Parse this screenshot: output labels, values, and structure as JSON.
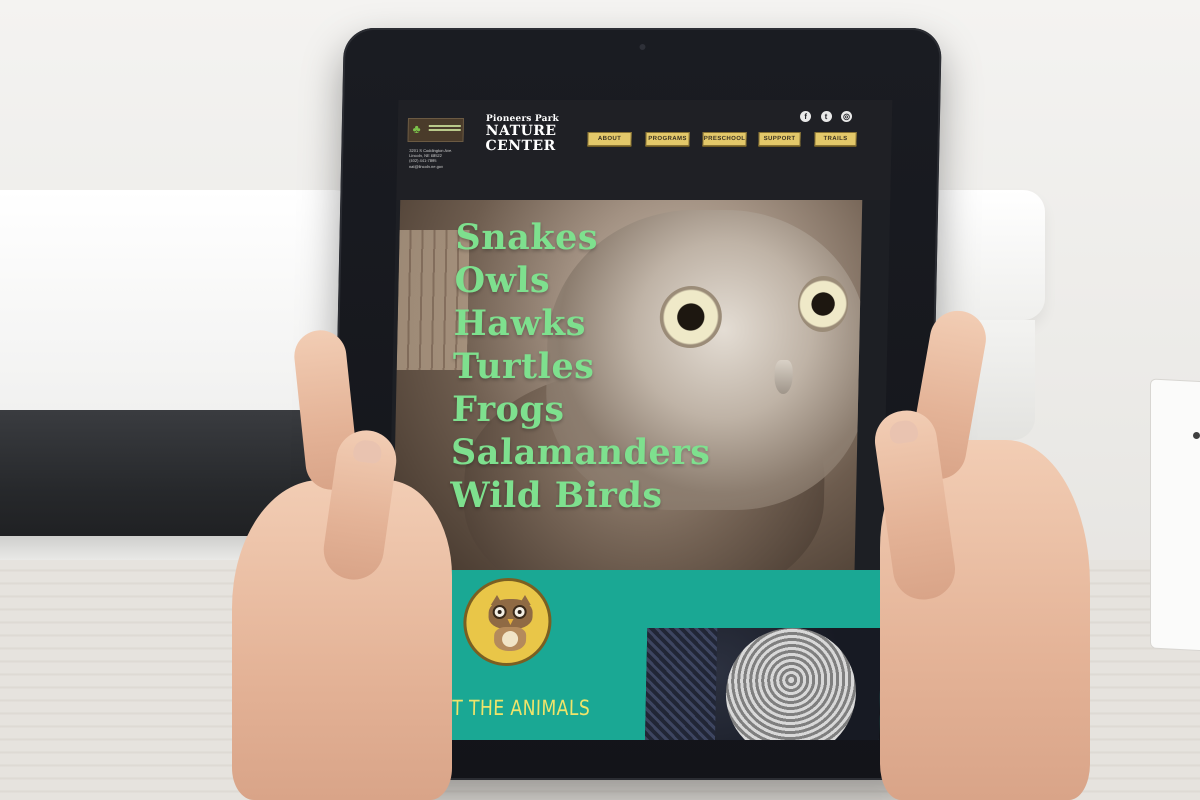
{
  "site": {
    "brand_line1": "Pioneers Park",
    "brand_line2": "NATURE",
    "brand_line3": "CENTER",
    "address": [
      "3201 S Coddington Ave.",
      "Lincoln, NE 68522",
      "(402) 441-7895",
      "nat@lincoln.ne.gov"
    ],
    "nav": [
      "ABOUT",
      "PROGRAMS",
      "PRESCHOOL",
      "SUPPORT",
      "TRAILS"
    ],
    "social_icons": [
      "facebook-icon",
      "twitter-icon",
      "instagram-icon"
    ]
  },
  "hero": {
    "animals": [
      "Snakes",
      "Owls",
      "Hawks",
      "Turtles",
      "Frogs",
      "Salamanders",
      "Wild Birds"
    ]
  },
  "feature": {
    "visit_label": "VISIT THE ANIMALS"
  },
  "colors": {
    "header_bg": "#1f2025",
    "nav_button": "#e3c86a",
    "hero_text": "#7ee08e",
    "teal_band": "#1aa894",
    "visit_text": "#f0e46a"
  }
}
